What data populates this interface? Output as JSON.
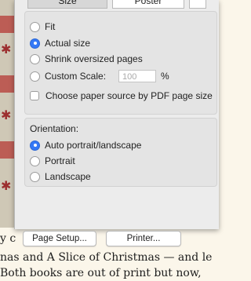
{
  "tabs": [
    "Size",
    "Poster",
    ""
  ],
  "scaling": {
    "options": [
      "Fit",
      "Actual size",
      "Shrink oversized pages",
      "Custom Scale:"
    ],
    "selected": "Actual size",
    "custom_scale_placeholder": "100",
    "percent_label": "%"
  },
  "paper_source_label": "Choose paper source by PDF page size",
  "orientation": {
    "label": "Orientation:",
    "options": [
      "Auto portrait/landscape",
      "Portrait",
      "Landscape"
    ],
    "selected": "Auto portrait/landscape"
  },
  "buttons": {
    "page_setup": "Page Setup...",
    "printer": "Printer..."
  },
  "background_text": {
    "line1": "y c",
    "line2": "nas and A Slice of Christmas — and le",
    "line3": "Both books are out of print but now,"
  },
  "colors": {
    "accent": "#3478f6",
    "dialog_bg": "#ececec"
  }
}
